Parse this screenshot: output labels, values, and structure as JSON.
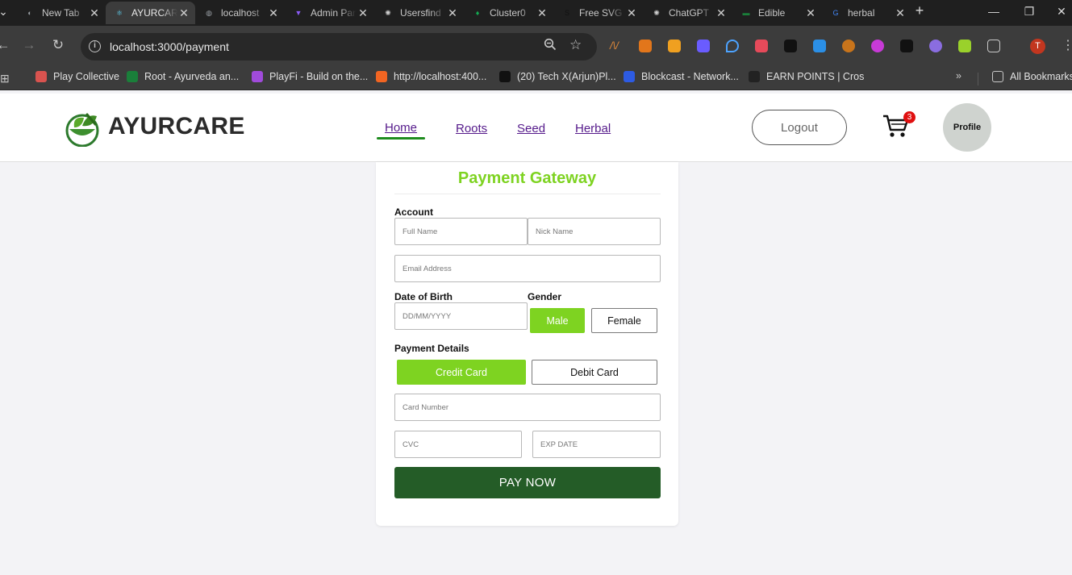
{
  "browser": {
    "tabs": [
      {
        "title": "New Tab",
        "color": "#9aa0a6",
        "glyph": "◐"
      },
      {
        "title": "AYURCARE",
        "color": "#61dafb",
        "glyph": "⚛",
        "active": true
      },
      {
        "title": "localhost",
        "color": "#9aa0a6",
        "glyph": "◍"
      },
      {
        "title": "Admin Panel",
        "color": "#8b5cf6",
        "glyph": "▼"
      },
      {
        "title": "Usersfind",
        "color": "#d0d0d0",
        "glyph": "✺"
      },
      {
        "title": "Cluster0",
        "color": "#13aa52",
        "glyph": "♦"
      },
      {
        "title": "Free SVG",
        "color": "#111111",
        "glyph": "S"
      },
      {
        "title": "ChatGPT",
        "color": "#d0d0d0",
        "glyph": "✺"
      },
      {
        "title": "Edible",
        "color": "#1a7f3a",
        "glyph": "▬"
      },
      {
        "title": "herbal",
        "color": "#4285f4",
        "glyph": "G"
      }
    ],
    "url": "localhost:3000/payment",
    "bookmarks": [
      {
        "label": "Play Collective",
        "color": "#d9534f"
      },
      {
        "label": "Root - Ayurveda an...",
        "color": "#1a7f3a"
      },
      {
        "label": "PlayFi - Build on the...",
        "color": "#a04bdb"
      },
      {
        "label": "http://localhost:400...",
        "color": "#f26522"
      },
      {
        "label": "(20) Tech X(Arjun)Pl...",
        "color": "#111111"
      },
      {
        "label": "Blockcast - Network...",
        "color": "#2d5be3"
      },
      {
        "label": "EARN POINTS | Cros",
        "color": "#222222"
      }
    ],
    "all_bookmarks_label": "All Bookmarks",
    "profile_initial": "T"
  },
  "site": {
    "brand": "AYURCARE",
    "nav": [
      {
        "label": "Home",
        "active": true
      },
      {
        "label": "Roots"
      },
      {
        "label": "Seed"
      },
      {
        "label": "Herbal"
      }
    ],
    "logout_label": "Logout",
    "cart_count": "3",
    "profile_label": "Profile"
  },
  "payment": {
    "title": "Payment Gateway",
    "account_label": "Account",
    "full_name_placeholder": "Full Name",
    "nick_name_placeholder": "Nick Name",
    "email_placeholder": "Email Address",
    "dob_label": "Date of Birth",
    "dob_placeholder": "DD/MM/YYYY",
    "gender_label": "Gender",
    "gender_options": [
      "Male",
      "Female"
    ],
    "gender_selected": "Male",
    "payment_details_label": "Payment Details",
    "payment_options": [
      "Credit Card",
      "Debit Card"
    ],
    "payment_selected": "Credit Card",
    "card_number_placeholder": "Card Number",
    "cvc_placeholder": "CVC",
    "exp_placeholder": "EXP DATE",
    "pay_label": "PAY NOW"
  },
  "colors": {
    "accent_green": "#7ed321",
    "pay_button": "#245c27",
    "nav_active_underline": "#1e8c1e",
    "cart_badge": "#e01010"
  }
}
